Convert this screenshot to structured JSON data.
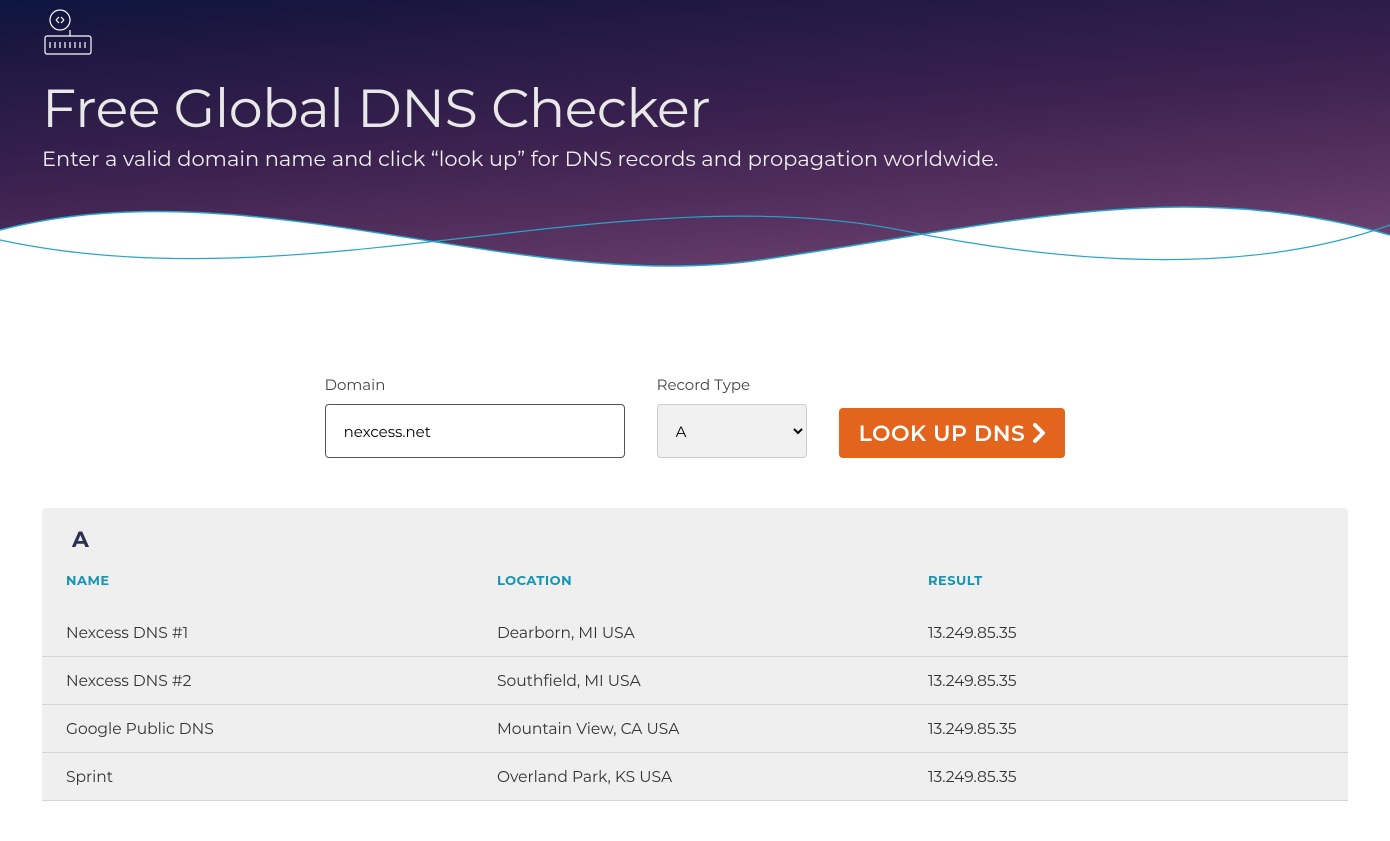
{
  "hero": {
    "title": "Free Global DNS Checker",
    "subtitle": "Enter a valid domain name and click “look up” for DNS records and propagation worldwide."
  },
  "form": {
    "domain_label": "Domain",
    "domain_value": "nexcess.net",
    "record_type_label": "Record Type",
    "record_type_value": "A",
    "record_type_options": [
      "A"
    ],
    "button_label": "LOOK UP DNS"
  },
  "results": {
    "record_type": "A",
    "columns": {
      "name": "NAME",
      "location": "LOCATION",
      "result": "RESULT"
    },
    "rows": [
      {
        "name": "Nexcess DNS #1",
        "location": "Dearborn, MI USA",
        "result": "13.249.85.35"
      },
      {
        "name": "Nexcess DNS #2",
        "location": "Southfield, MI USA",
        "result": "13.249.85.35"
      },
      {
        "name": "Google Public DNS",
        "location": "Mountain View, CA USA",
        "result": "13.249.85.35"
      },
      {
        "name": "Sprint",
        "location": "Overland Park, KS USA",
        "result": "13.249.85.35"
      }
    ]
  },
  "colors": {
    "accent_orange": "#e3641c",
    "heading_teal": "#1594b4",
    "dark_navy": "#2c3054"
  }
}
